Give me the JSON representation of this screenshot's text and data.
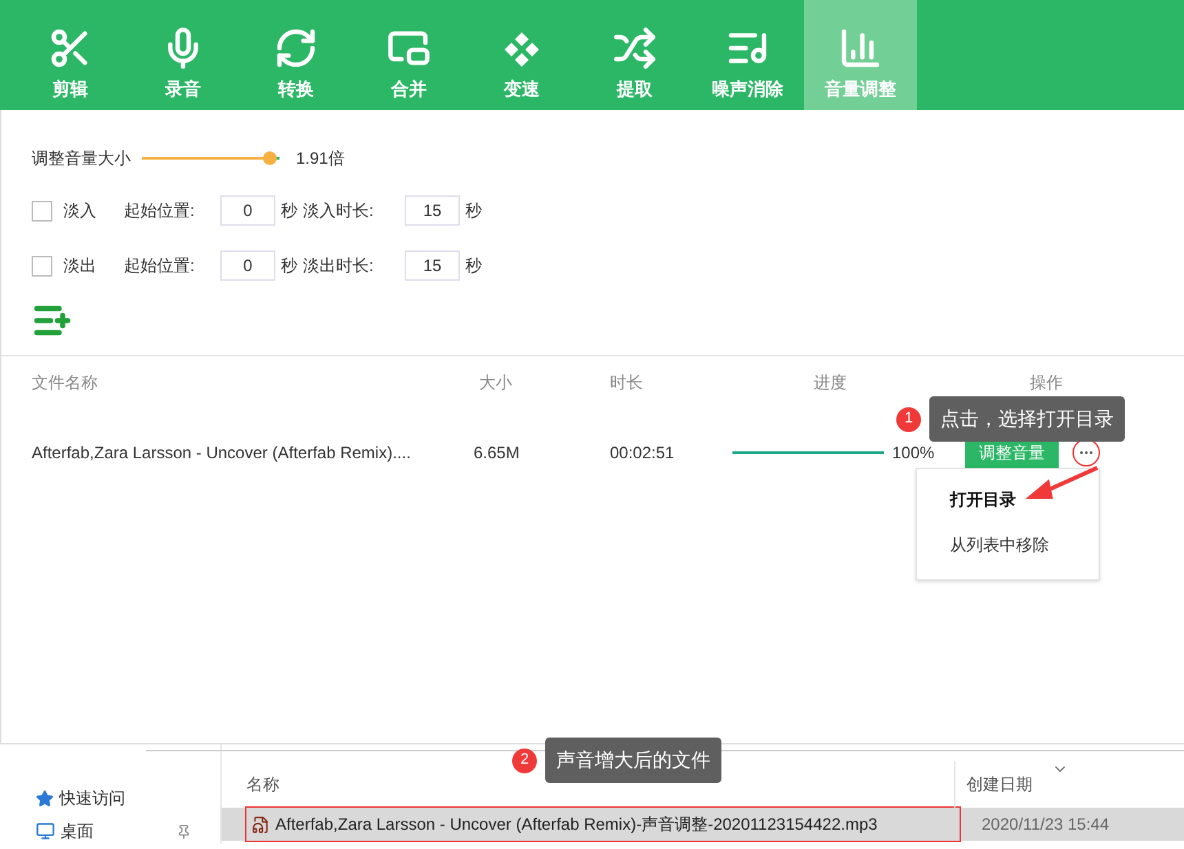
{
  "toolbar": [
    {
      "label": "剪辑",
      "kind": "scissors",
      "selected": false
    },
    {
      "label": "录音",
      "kind": "mic",
      "selected": false
    },
    {
      "label": "转换",
      "kind": "convert",
      "selected": false
    },
    {
      "label": "合并",
      "kind": "merge",
      "selected": false
    },
    {
      "label": "变速",
      "kind": "speed",
      "selected": false
    },
    {
      "label": "提取",
      "kind": "shuffle",
      "selected": false
    },
    {
      "label": "噪声消除",
      "kind": "music-list",
      "selected": false
    },
    {
      "label": "音量调整",
      "kind": "bars",
      "selected": true
    }
  ],
  "volume": {
    "label": "调整音量大小",
    "level": 0.93,
    "reading": "1.91倍"
  },
  "fades": [
    {
      "label": "淡入",
      "checked": false,
      "start_label": "起始位置:",
      "start": "0",
      "unit1": "秒",
      "duration_label": "淡入时长:",
      "duration": "15",
      "unit2": "秒"
    },
    {
      "label": "淡出",
      "checked": false,
      "start_label": "起始位置:",
      "start": "0",
      "unit1": "秒",
      "duration_label": "淡出时长:",
      "duration": "15",
      "unit2": "秒"
    }
  ],
  "table": {
    "columns": [
      "文件名称",
      "大小",
      "时长",
      "进度",
      "操作"
    ],
    "rows": [
      {
        "name": "Afterfab,Zara Larsson - Uncover (Afterfab Remix)....",
        "size": "6.65M",
        "duration": "00:02:51",
        "level": 1,
        "percent": "100%",
        "action": "调整音量"
      }
    ]
  },
  "menu": {
    "items": [
      {
        "label": "打开目录",
        "selected": true
      },
      {
        "label": "从列表中移除",
        "selected": false
      }
    ]
  },
  "callouts": [
    {
      "number": "1",
      "text": "点击，选择打开目录"
    },
    {
      "number": "2",
      "text": "声音增大后的文件"
    }
  ],
  "explorer": {
    "sidebar": [
      {
        "label": "快速访问",
        "kind": "star"
      },
      {
        "label": "桌面",
        "kind": "desktop"
      }
    ],
    "columns": [
      "名称",
      "创建日期"
    ],
    "rows": [
      {
        "name": "Afterfab,Zara Larsson - Uncover (Afterfab Remix)-声音调整-20201123154422.mp3",
        "date": "2020/11/23 15:44",
        "selected": true
      }
    ]
  }
}
